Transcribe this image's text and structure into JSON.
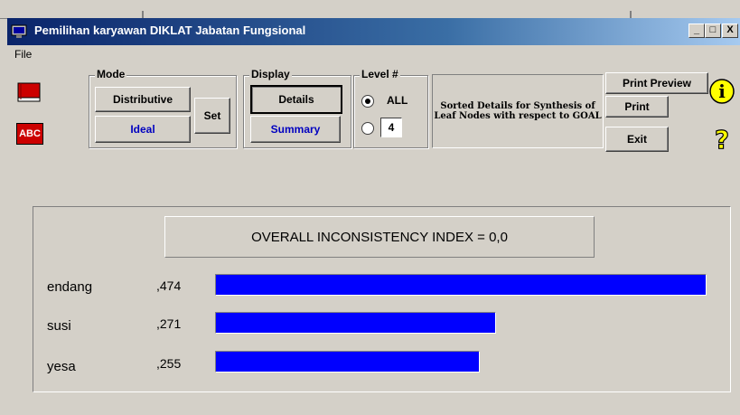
{
  "window": {
    "title": "Pemilihan karyawan DIKLAT Jabatan Fungsional",
    "minimize": "_",
    "maximize": "□",
    "close": "X"
  },
  "menu": {
    "file": "File"
  },
  "toolbar_icons": {
    "book": "book-icon",
    "spell": "abc-icon",
    "spell_text": "ABC",
    "info": "info-icon",
    "help": "help-icon"
  },
  "mode": {
    "label": "Mode",
    "distributive": "Distributive",
    "ideal": "Ideal",
    "set": "Set"
  },
  "display": {
    "label": "Display",
    "details": "Details",
    "summary": "Summary"
  },
  "level": {
    "label": "Level #",
    "all": "ALL",
    "value": "4"
  },
  "sort_text": "Sorted Details for Synthesis of Leaf Nodes with respect to GOAL",
  "actions": {
    "print_preview": "Print Preview",
    "print": "Print",
    "exit": "Exit"
  },
  "inconsistency": "OVERALL INCONSISTENCY INDEX =  0,0",
  "colors": {
    "bar": "#0000ff",
    "titlebar": "#0a246a"
  },
  "results": [
    {
      "name": "endang",
      "value_label": ",474",
      "value": 0.474
    },
    {
      "name": "susi",
      "value_label": ",271",
      "value": 0.271
    },
    {
      "name": "yesa",
      "value_label": ",255",
      "value": 0.255
    }
  ]
}
